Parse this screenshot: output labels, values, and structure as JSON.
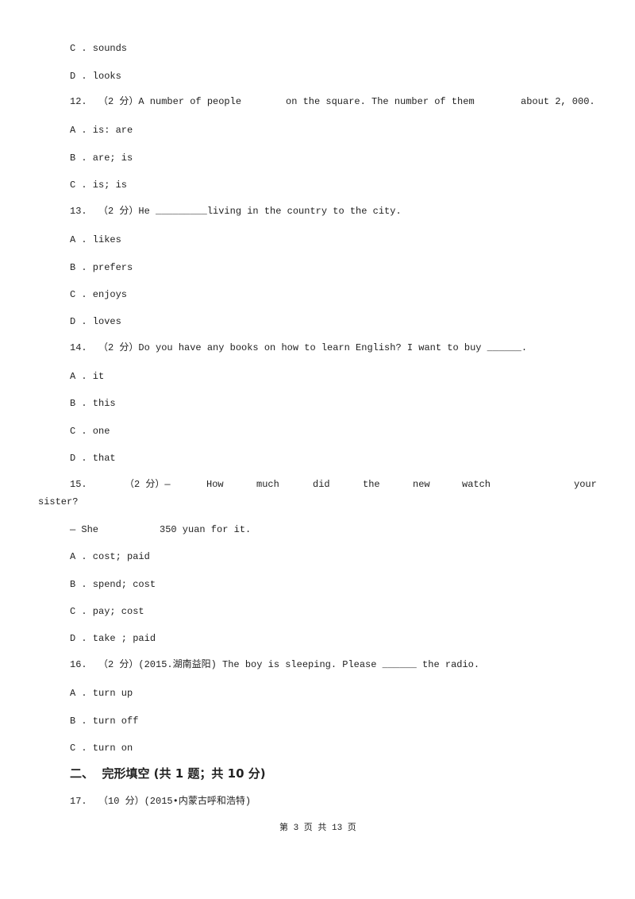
{
  "q11": {
    "options": [
      "C . sounds",
      "D . looks"
    ]
  },
  "q12": {
    "prefix": "12.  （2 分）A number of people",
    "mid": "on the square. The number of them",
    "end": "about 2, 000.",
    "options": [
      "A . is: are",
      "B . are; is",
      "C . is; is"
    ]
  },
  "q13": {
    "stem": "13.  （2 分）He _________living in the country to the city.",
    "options": [
      "A . likes",
      "B . prefers",
      "C . enjoys",
      "D . loves"
    ]
  },
  "q14": {
    "stem": "14.  （2 分）Do you have any books on how to learn English? I want to buy ______.",
    "options": [
      "A . it",
      "B . this",
      "C . one",
      "D . that"
    ]
  },
  "q15": {
    "words": [
      "15.",
      "（2 分）—",
      "How",
      "much",
      "did",
      "the",
      "new",
      "watch",
      "your"
    ],
    "line2": "sister?",
    "reply_a": "— She",
    "reply_b": "350 yuan for it.",
    "options": [
      "A . cost; paid",
      "B . spend; cost",
      "C . pay; cost",
      "D . take ; paid"
    ]
  },
  "q16": {
    "stem": "16.  （2 分）(2015.湖南益阳) The boy is sleeping. Please ______ the radio.",
    "options": [
      "A . turn up",
      "B . turn off",
      "C . turn on"
    ]
  },
  "section2": {
    "heading": "二、  完形填空 (共 1 题；共 10 分)"
  },
  "q17": {
    "stem": "17.  （10 分）(2015•内蒙古呼和浩特)"
  },
  "footer": {
    "page": "第 3 页 共 13 页"
  }
}
